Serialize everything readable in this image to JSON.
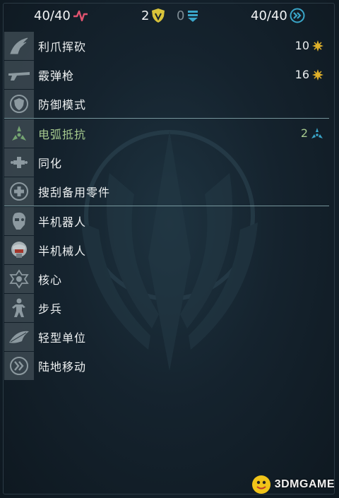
{
  "header": {
    "health": {
      "value": "40/40",
      "icon": "heartbeat-icon",
      "color": "#e0536f"
    },
    "armor": {
      "value": "2",
      "icon": "shield-icon",
      "color": "#d8c33a"
    },
    "shield": {
      "value": "0",
      "icon": "energy-shield-icon",
      "color": "#3aa6c9"
    },
    "movement": {
      "value": "40/40",
      "icon": "movement-icon",
      "color": "#3aa6c9"
    }
  },
  "abilities": [
    {
      "label": "利爪挥砍",
      "value": "10",
      "value_icon": "burst-icon",
      "icon": "claw-icon"
    },
    {
      "label": "霰弹枪",
      "value": "16",
      "value_icon": "burst-icon",
      "icon": "shotgun-icon"
    },
    {
      "label": "防御模式",
      "value": "",
      "icon": "defense-shield-icon"
    }
  ],
  "resistance": [
    {
      "label": "电弧抵抗",
      "value": "2",
      "value_icon": "arc-resist-icon",
      "icon": "arc-icon"
    },
    {
      "label": "同化",
      "value": "",
      "icon": "assimilate-icon"
    },
    {
      "label": "搜刮备用零件",
      "value": "",
      "icon": "repair-plus-icon"
    }
  ],
  "traits": [
    {
      "label": "半机器人",
      "icon": "cyborg-icon"
    },
    {
      "label": "半机械人",
      "icon": "mech-head-icon"
    },
    {
      "label": "核心",
      "icon": "core-icon"
    },
    {
      "label": "步兵",
      "icon": "infantry-icon"
    },
    {
      "label": "轻型单位",
      "icon": "feather-icon"
    },
    {
      "label": "陆地移动",
      "icon": "land-move-icon"
    }
  ],
  "colors": {
    "highlight": "#a5c98e",
    "burst": "#e0b12a",
    "arc": "#3aa6c9"
  },
  "watermark": {
    "text": "3DMGAME"
  }
}
